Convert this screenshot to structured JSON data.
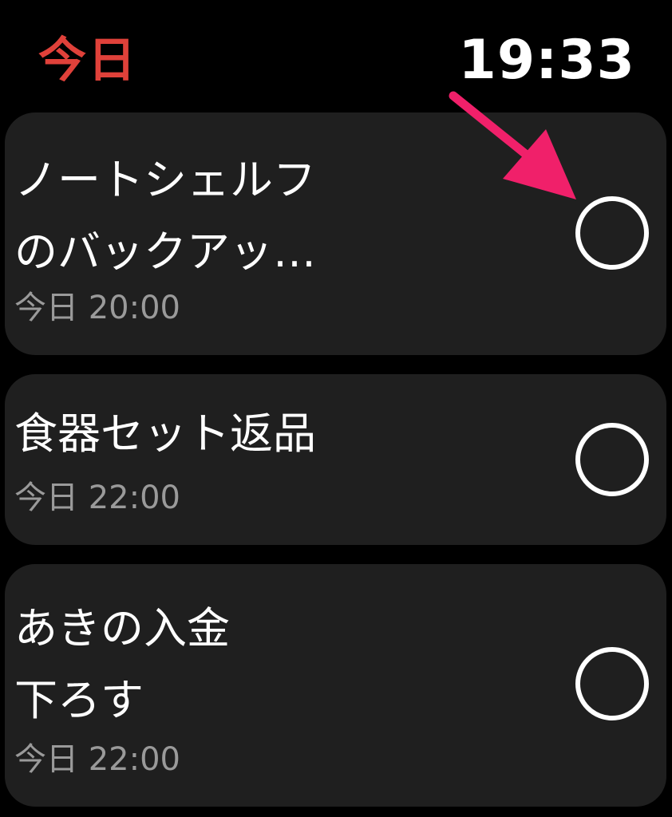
{
  "header": {
    "title": "今日",
    "time": "19:33"
  },
  "colors": {
    "accent": "#e0413a",
    "background": "#000000",
    "card": "#1f1f1f",
    "secondary_text": "#9a9a9a",
    "annotation_arrow": "#f0206a"
  },
  "tasks": [
    {
      "title_lines": [
        "ノートシェルフ",
        "のバックアッ…"
      ],
      "due": "今日 20:00",
      "completed": false
    },
    {
      "title_lines": [
        "食器セット返品"
      ],
      "due": "今日 22:00",
      "completed": false
    },
    {
      "title_lines": [
        "あきの入金",
        "下ろす"
      ],
      "due": "今日 22:00",
      "completed": false
    }
  ],
  "icons": {
    "complete_toggle": "circle-outline-icon",
    "annotation": "arrow-icon"
  }
}
